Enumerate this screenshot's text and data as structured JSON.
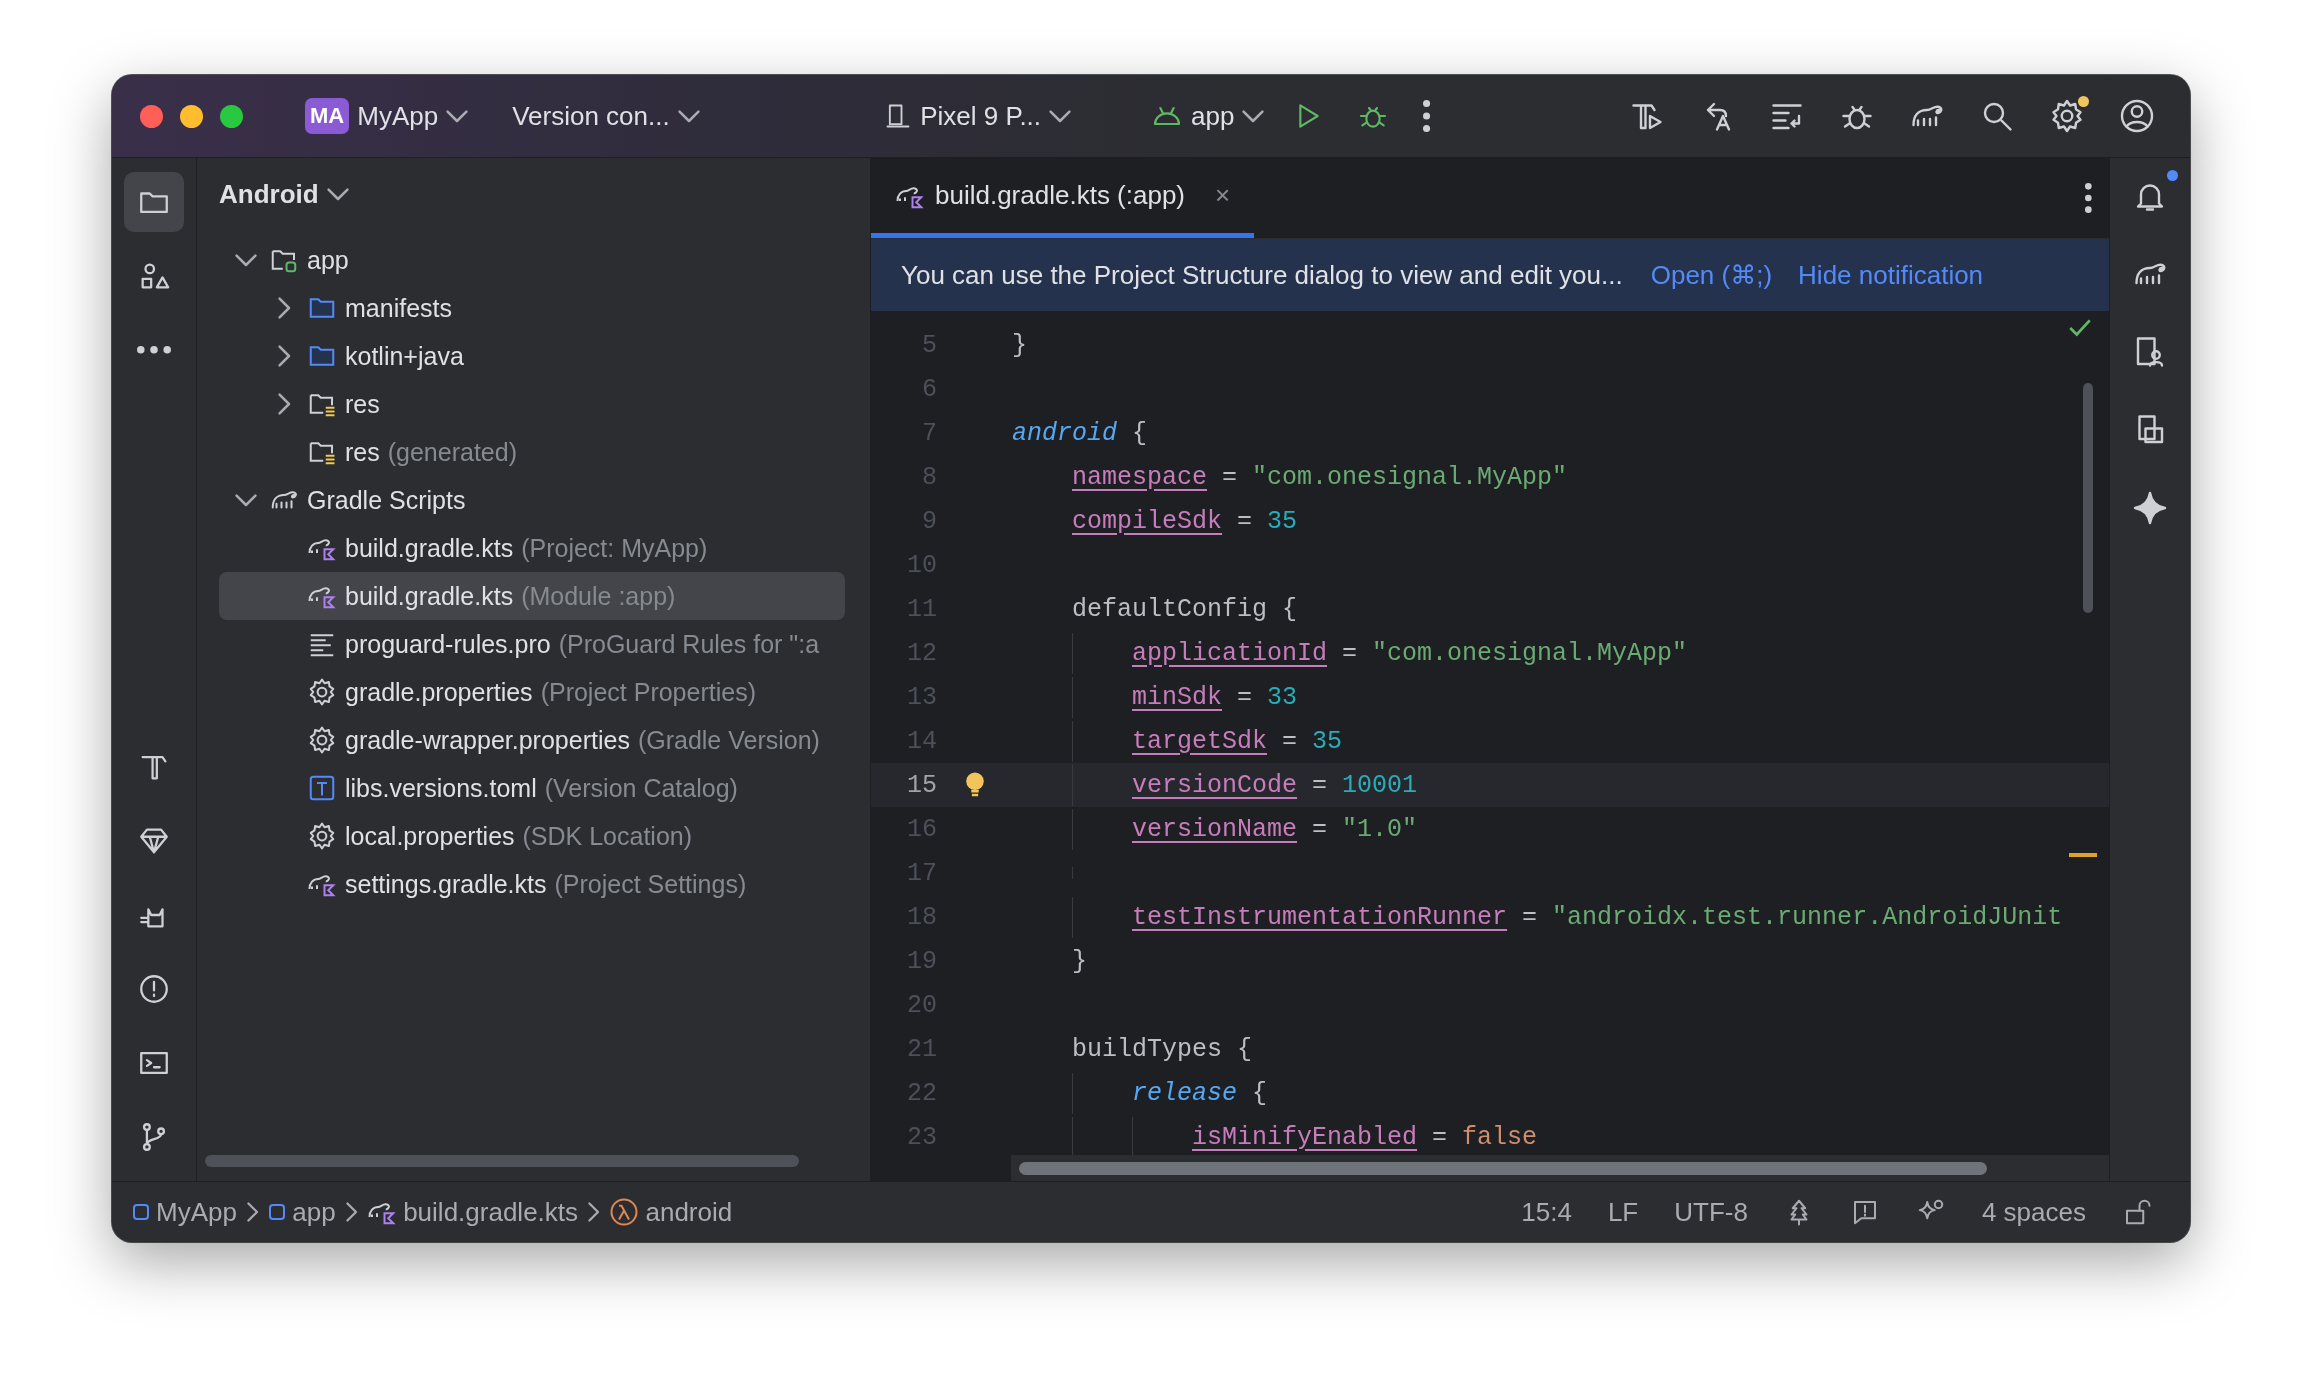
{
  "title_bar": {
    "project": {
      "badge": "MA",
      "name": "MyApp"
    },
    "vcs": "Version con...",
    "device": "Pixel 9 P...",
    "run_config": "app",
    "run_actions": [
      {
        "kind": "run"
      },
      {
        "kind": "debug"
      },
      {
        "kind": "more"
      }
    ],
    "tools": [
      {
        "kind": "build",
        "dot": false
      },
      {
        "kind": "translate",
        "dot": false
      },
      {
        "kind": "list",
        "dot": false
      },
      {
        "kind": "bug",
        "dot": false
      },
      {
        "kind": "gradle",
        "dot": false
      },
      {
        "kind": "search",
        "dot": false
      },
      {
        "kind": "settings",
        "dot": true
      },
      {
        "kind": "profile",
        "dot": false
      }
    ]
  },
  "left_stripe": {
    "top": [
      {
        "kind": "project",
        "selected": true
      },
      {
        "kind": "shapes",
        "selected": false
      },
      {
        "kind": "more",
        "selected": false
      }
    ],
    "bottom": [
      {
        "kind": "hammer",
        "selected": false
      },
      {
        "kind": "gem",
        "selected": false
      },
      {
        "kind": "cat",
        "selected": false
      },
      {
        "kind": "alert",
        "selected": false
      },
      {
        "kind": "terminal",
        "selected": false
      },
      {
        "kind": "branch",
        "selected": false
      }
    ]
  },
  "project_panel": {
    "view": "Android",
    "tree": [
      {
        "label": "app",
        "kind": "module",
        "expanded": true,
        "selected": false,
        "children": [
          {
            "label": "manifests",
            "kind": "folder",
            "expanded": false,
            "selected": false
          },
          {
            "label": "kotlin+java",
            "kind": "folder",
            "expanded": false,
            "selected": false
          },
          {
            "label": "res",
            "kind": "res",
            "expanded": false,
            "selected": false
          },
          {
            "label": "res",
            "hint": "(generated)",
            "kind": "res",
            "selected": false
          }
        ]
      },
      {
        "label": "Gradle Scripts",
        "kind": "gradle",
        "expanded": true,
        "selected": false,
        "children": [
          {
            "label": "build.gradle.kts",
            "hint": "(Project: MyApp)",
            "kind": "kts",
            "selected": false
          },
          {
            "label": "build.gradle.kts",
            "hint": "(Module :app)",
            "kind": "kts",
            "selected": true
          },
          {
            "label": "proguard-rules.pro",
            "hint": "(ProGuard Rules for \":a",
            "kind": "lines",
            "selected": false
          },
          {
            "label": "gradle.properties",
            "hint": "(Project Properties)",
            "kind": "gear",
            "selected": false
          },
          {
            "label": "gradle-wrapper.properties",
            "hint": "(Gradle Version)",
            "kind": "gear",
            "selected": false
          },
          {
            "label": "libs.versions.toml",
            "hint": "(Version Catalog)",
            "kind": "toml",
            "selected": false
          },
          {
            "label": "local.properties",
            "hint": "(SDK Location)",
            "kind": "gear",
            "selected": false
          },
          {
            "label": "settings.gradle.kts",
            "hint": "(Project Settings)",
            "kind": "kts",
            "selected": false
          }
        ]
      }
    ]
  },
  "editor": {
    "tabs": [
      {
        "label": "build.gradle.kts (:app)",
        "close": "×",
        "selected": true
      }
    ],
    "notification": {
      "text": "You can use the Project Structure dialog to view and edit you...",
      "actions": [
        "Open (⌘;)",
        "Hide notification"
      ]
    },
    "lines": [
      {
        "number": "5",
        "current": false,
        "tokens": [
          {
            "kind": "plain",
            "text": "}"
          }
        ]
      },
      {
        "number": "6",
        "current": false
      },
      {
        "number": "7",
        "current": false,
        "tokens": [
          {
            "kind": "keyword",
            "text": "android"
          },
          {
            "kind": "plain",
            "text": " {"
          }
        ],
        "children": [
          {
            "number": "8",
            "current": false,
            "tokens": [
              {
                "kind": "property",
                "text": "namespace"
              },
              {
                "kind": "plain",
                "text": " = "
              },
              {
                "kind": "string",
                "text": "\"com.onesignal.MyApp\""
              }
            ]
          },
          {
            "number": "9",
            "current": false,
            "tokens": [
              {
                "kind": "property",
                "text": "compileSdk"
              },
              {
                "kind": "plain",
                "text": " = "
              },
              {
                "kind": "number",
                "text": "35"
              }
            ]
          },
          {
            "number": "10",
            "current": false
          },
          {
            "number": "11",
            "current": false,
            "tokens": [
              {
                "kind": "plain",
                "text": "defaultConfig {"
              }
            ],
            "children": [
              {
                "number": "12",
                "current": false,
                "tokens": [
                  {
                    "kind": "property",
                    "text": "applicationId"
                  },
                  {
                    "kind": "plain",
                    "text": " = "
                  },
                  {
                    "kind": "string",
                    "text": "\"com.onesignal.MyApp\""
                  }
                ]
              },
              {
                "number": "13",
                "current": false,
                "tokens": [
                  {
                    "kind": "property",
                    "text": "minSdk"
                  },
                  {
                    "kind": "plain",
                    "text": " = "
                  },
                  {
                    "kind": "number",
                    "text": "33"
                  }
                ]
              },
              {
                "number": "14",
                "current": false,
                "tokens": [
                  {
                    "kind": "property",
                    "text": "targetSdk"
                  },
                  {
                    "kind": "plain",
                    "text": " = "
                  },
                  {
                    "kind": "number",
                    "text": "35"
                  }
                ]
              },
              {
                "number": "15",
                "current": true,
                "bulb": true,
                "tokens": [
                  {
                    "kind": "property",
                    "text": "versionCode"
                  },
                  {
                    "kind": "plain",
                    "text": " = "
                  },
                  {
                    "kind": "number",
                    "text": "10001"
                  }
                ]
              },
              {
                "number": "16",
                "current": false,
                "tokens": [
                  {
                    "kind": "property",
                    "text": "versionName"
                  },
                  {
                    "kind": "plain",
                    "text": " = "
                  },
                  {
                    "kind": "string",
                    "text": "\"1.0\""
                  }
                ]
              },
              {
                "number": "17",
                "current": false
              },
              {
                "number": "18",
                "current": false,
                "tokens": [
                  {
                    "kind": "property",
                    "text": "testInstrumentationRunner"
                  },
                  {
                    "kind": "plain",
                    "text": " = "
                  },
                  {
                    "kind": "string",
                    "text": "\"androidx.test.runner.AndroidJUnit"
                  }
                ]
              }
            ]
          },
          {
            "number": "19",
            "current": false,
            "tokens": [
              {
                "kind": "plain",
                "text": "}"
              }
            ]
          },
          {
            "number": "20",
            "current": false
          },
          {
            "number": "21",
            "current": false,
            "tokens": [
              {
                "kind": "plain",
                "text": "buildTypes {"
              }
            ],
            "children": [
              {
                "number": "22",
                "current": false,
                "tokens": [
                  {
                    "kind": "keyword",
                    "text": "release"
                  },
                  {
                    "kind": "plain",
                    "text": " {"
                  }
                ],
                "children": [
                  {
                    "number": "23",
                    "current": false,
                    "tokens": [
                      {
                        "kind": "property",
                        "text": "isMinifyEnabled"
                      },
                      {
                        "kind": "plain",
                        "text": " = "
                      },
                      {
                        "kind": "boolean",
                        "text": "false"
                      }
                    ]
                  }
                ]
              }
            ]
          }
        ]
      }
    ]
  },
  "right_stripe": [
    {
      "kind": "notifications",
      "dot": true
    },
    {
      "kind": "gradle",
      "dot": false
    },
    {
      "kind": "device-manager",
      "dot": false
    },
    {
      "kind": "running-devices",
      "dot": false
    },
    {
      "kind": "sparkle",
      "dot": false
    }
  ],
  "status_bar": {
    "breadcrumbs": [
      {
        "label": "MyApp",
        "kind": "module"
      },
      {
        "label": "app",
        "kind": "module"
      },
      {
        "label": "build.gradle.kts",
        "kind": "kts"
      },
      {
        "label": "android",
        "kind": "lambda"
      }
    ],
    "items": [
      {
        "kind": "text",
        "label": "15:4"
      },
      {
        "kind": "text",
        "label": "LF"
      },
      {
        "kind": "text",
        "label": "UTF-8"
      },
      {
        "kind": "tree-icon"
      },
      {
        "kind": "alert-icon"
      },
      {
        "kind": "ai-icon"
      },
      {
        "kind": "text",
        "label": "4 spaces"
      },
      {
        "kind": "lock-icon"
      }
    ]
  }
}
